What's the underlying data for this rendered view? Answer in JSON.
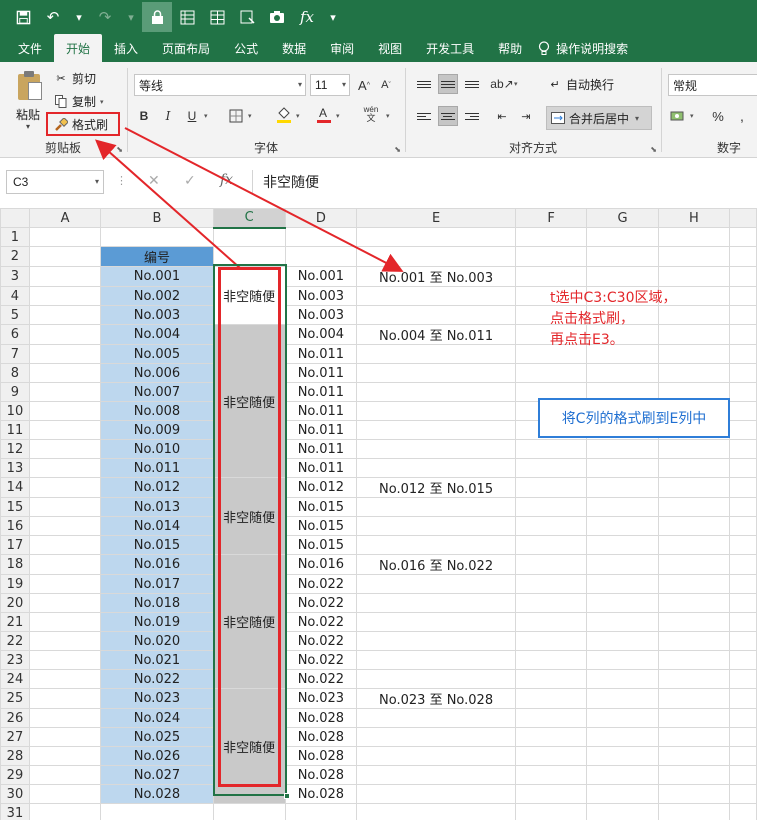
{
  "quick_access": {
    "icons": [
      "save-icon",
      "undo-icon",
      "redo-icon",
      "lock-icon",
      "form-icon",
      "table-icon",
      "save-as-icon",
      "camera-icon",
      "fx-icon",
      "customize-icon"
    ],
    "fx_label": "fx"
  },
  "menu": {
    "tabs": [
      "文件",
      "开始",
      "插入",
      "页面布局",
      "公式",
      "数据",
      "审阅",
      "视图",
      "开发工具",
      "帮助"
    ],
    "active": "开始",
    "search_label": "操作说明搜索"
  },
  "ribbon": {
    "clipboard": {
      "paste": "粘贴",
      "cut": "剪切",
      "copy": "复制",
      "format_painter": "格式刷",
      "group": "剪贴板"
    },
    "font": {
      "font_name": "等线",
      "font_size": "11",
      "bold": "B",
      "italic": "I",
      "underline": "U",
      "group": "字体"
    },
    "alignment": {
      "wrap_text": "自动换行",
      "merge_center": "合并后居中",
      "group": "对齐方式"
    },
    "number": {
      "format": "常规",
      "percent": "%",
      "group": "数字"
    }
  },
  "formula_bar": {
    "name_box": "C3",
    "fx": "fx",
    "content": "非空随便"
  },
  "sheet": {
    "columns": [
      "A",
      "B",
      "C",
      "D",
      "E",
      "F",
      "G",
      "H"
    ],
    "selected_column": "C",
    "row_numbers": [
      "1",
      "2",
      "3",
      "4",
      "5",
      "6",
      "7",
      "8",
      "9",
      "10",
      "11",
      "12",
      "13",
      "14",
      "15",
      "16",
      "17",
      "18",
      "19",
      "20",
      "21",
      "22",
      "23",
      "24",
      "25",
      "26",
      "27",
      "28",
      "29",
      "30",
      "31"
    ],
    "b_header": "编号",
    "b_values": [
      "No.001",
      "No.002",
      "No.003",
      "No.004",
      "No.005",
      "No.006",
      "No.007",
      "No.008",
      "No.009",
      "No.010",
      "No.011",
      "No.012",
      "No.013",
      "No.014",
      "No.015",
      "No.016",
      "No.017",
      "No.018",
      "No.019",
      "No.020",
      "No.021",
      "No.022",
      "No.023",
      "No.024",
      "No.025",
      "No.026",
      "No.027",
      "No.028"
    ],
    "c_merged_text": "非空随便",
    "d_values": [
      "No.001",
      "No.003",
      "No.003",
      "No.004",
      "No.011",
      "No.011",
      "No.011",
      "No.011",
      "No.011",
      "No.011",
      "No.011",
      "No.012",
      "No.015",
      "No.015",
      "No.015",
      "No.016",
      "No.022",
      "No.022",
      "No.022",
      "No.022",
      "No.022",
      "No.022",
      "No.023",
      "No.028",
      "No.028",
      "No.028",
      "No.028",
      "No.028"
    ],
    "e_values": {
      "3": "No.001  至  No.003",
      "6": "No.004  至  No.011",
      "14": "No.012  至  No.015",
      "18": "No.016  至  No.022",
      "25": "No.023  至  No.028"
    }
  },
  "annotations": {
    "instruction_lines": [
      "t选中C3:C30区域，",
      "点击格式刷，",
      "再点击E3。"
    ],
    "callout": "将C列的格式刷到E列中",
    "accent_red": "#e3262a",
    "accent_blue": "#2f7ed8",
    "excel_green": "#217346"
  }
}
